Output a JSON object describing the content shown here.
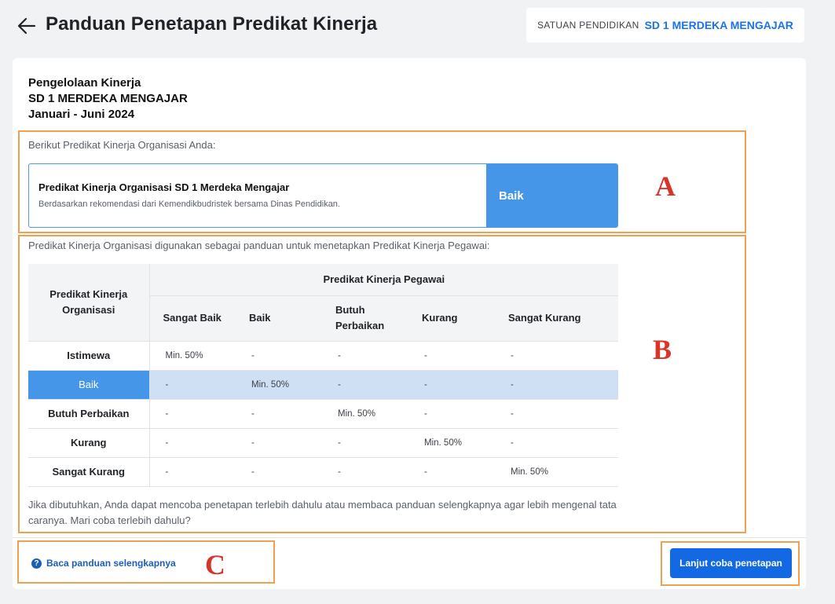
{
  "header": {
    "title": "Panduan Penetapan Predikat Kinerja",
    "unit_label": "SATUAN PENDIDIKAN",
    "unit_value": "SD 1 MERDEKA MENGAJAR"
  },
  "card": {
    "heading_line1": "Pengelolaan Kinerja",
    "heading_line2": "SD 1 MERDEKA MENGAJAR",
    "heading_line3": "Januari - Juni 2024"
  },
  "section_a": {
    "intro": "Berikut Predikat Kinerja Organisasi Anda:",
    "predicate_title": "Predikat Kinerja Organisasi SD 1 Merdeka Mengajar",
    "predicate_sub": "Berdasarkan rekomendasi dari Kemendikbudristek bersama Dinas Pendidikan.",
    "predicate_value": "Baik"
  },
  "section_b": {
    "intro": "Predikat Kinerja Organisasi digunakan sebagai panduan untuk menetapkan Predikat Kinerja Pegawai:",
    "org_header": "Predikat Kinerja Organisasi",
    "group_header": "Predikat Kinerja Pegawai",
    "columns": [
      "Sangat Baik",
      "Baik",
      "Butuh Perbaikan",
      "Kurang",
      "Sangat Kurang"
    ],
    "rows": [
      {
        "label": "Istimewa",
        "cells": [
          "Min. 50%",
          "-",
          "-",
          "-",
          "-"
        ],
        "highlighted": false
      },
      {
        "label": "Baik",
        "cells": [
          "-",
          "Min. 50%",
          "-",
          "-",
          "-"
        ],
        "highlighted": true
      },
      {
        "label": "Butuh Perbaikan",
        "cells": [
          "-",
          "-",
          "Min. 50%",
          "-",
          "-"
        ],
        "highlighted": false
      },
      {
        "label": "Kurang",
        "cells": [
          "-",
          "-",
          "-",
          "Min. 50%",
          "-"
        ],
        "highlighted": false
      },
      {
        "label": "Sangat Kurang",
        "cells": [
          "-",
          "-",
          "-",
          "-",
          "Min. 50%"
        ],
        "highlighted": false
      }
    ],
    "footnote": "Jika dibutuhkan, Anda dapat mencoba penetapan terlebih dahulu atau membaca panduan selengkapnya agar lebih mengenal tata caranya. Mari coba terlebih dahulu?"
  },
  "footer": {
    "guide_link": "Baca panduan selengkapnya",
    "cta_button": "Lanjut coba penetapan"
  },
  "annotations": {
    "a": "A",
    "b": "B",
    "c": "C"
  },
  "colors": {
    "accent": "#1269e3",
    "highlight_row": "#cfe0f5",
    "predicate_fill": "#4596e8",
    "annotation_box": "#f0a050",
    "annotation_letter": "#d9342a"
  }
}
